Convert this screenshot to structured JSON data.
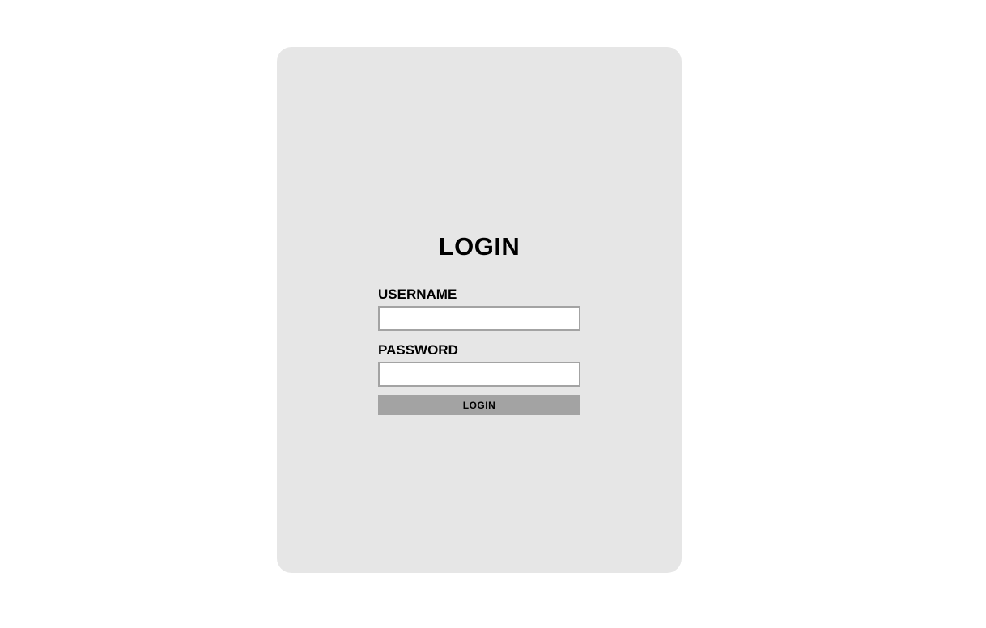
{
  "login": {
    "title": "LOGIN",
    "username_label": "USERNAME",
    "username_value": "",
    "password_label": "PASSWORD",
    "password_value": "",
    "submit_label": "LOGIN"
  },
  "colors": {
    "page_background": "#ffffff",
    "card_background": "#e6e6e6",
    "field_border": "#a3a3a3",
    "button_background": "#a3a3a3"
  }
}
